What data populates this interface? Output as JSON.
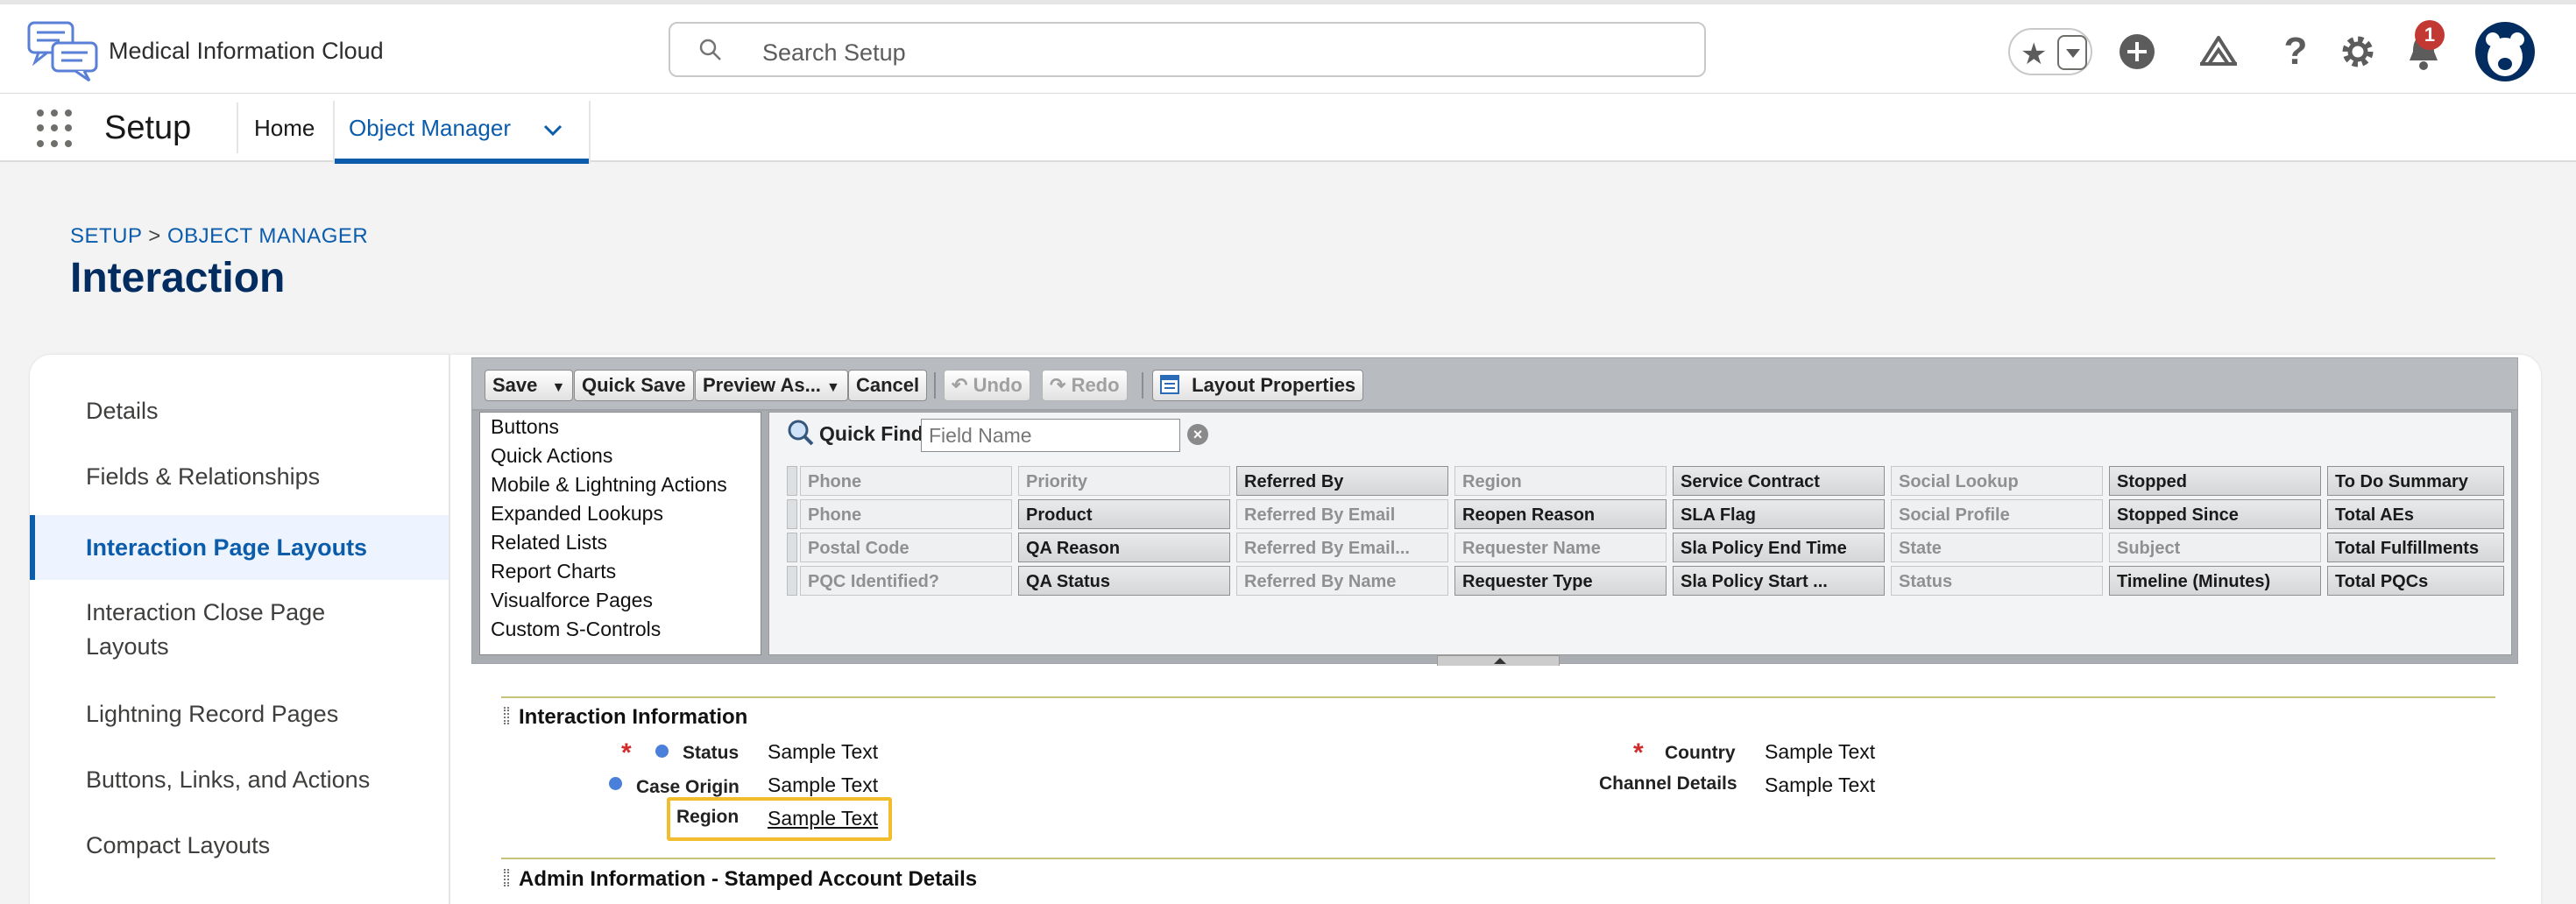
{
  "header": {
    "app_name": "Medical Information Cloud",
    "search_placeholder": "Search Setup",
    "notification_count": "1",
    "icons": [
      "favorites-star-icon",
      "favorites-dropdown-icon",
      "add-icon",
      "trailhead-icon",
      "help-icon",
      "gear-icon",
      "bell-icon",
      "avatar"
    ]
  },
  "context_bar": {
    "title": "Setup",
    "tabs": [
      {
        "label": "Home"
      },
      {
        "label": "Object Manager",
        "active": true
      }
    ]
  },
  "breadcrumb": {
    "setup": "SETUP",
    "separator": ">",
    "object_manager": "OBJECT MANAGER"
  },
  "page_title": "Interaction",
  "sidebar": {
    "items": [
      {
        "label": "Details"
      },
      {
        "label": "Fields & Relationships"
      },
      {
        "label": "Interaction Page Layouts",
        "active": true
      },
      {
        "label_line1": "Interaction Close Page",
        "label_line2": "Layouts"
      },
      {
        "label": "Lightning Record Pages"
      },
      {
        "label": "Buttons, Links, and Actions"
      },
      {
        "label": "Compact Layouts"
      }
    ]
  },
  "toolbar": {
    "save": "Save",
    "quick_save": "Quick Save",
    "preview_as": "Preview As...",
    "cancel": "Cancel",
    "undo": "Undo",
    "redo": "Redo",
    "layout_properties": "Layout Properties"
  },
  "palette": {
    "categories": [
      "Buttons",
      "Quick Actions",
      "Mobile & Lightning Actions",
      "Expanded Lookups",
      "Related Lists",
      "Report Charts",
      "Visualforce Pages",
      "Custom S-Controls"
    ],
    "quick_find_label": "Quick Find",
    "quick_find_placeholder": "Field Name",
    "columns": [
      [
        "Phone",
        "Phone",
        "Postal Code",
        "PQC Identified?"
      ],
      [
        "Priority",
        "Product",
        "QA Reason",
        "QA Status"
      ],
      [
        "Referred By",
        "Referred By Email",
        "Referred By Email...",
        "Referred By Name"
      ],
      [
        "Region",
        "Reopen Reason",
        "Requester Name",
        "Requester Type"
      ],
      [
        "Service Contract",
        "SLA Flag",
        "Sla Policy End Time",
        "Sla Policy Start ..."
      ],
      [
        "Social Lookup",
        "Social Profile",
        "State",
        "Status"
      ],
      [
        "Stopped",
        "Stopped Since",
        "Subject",
        "Timeline (Minutes)"
      ],
      [
        "To Do Summary",
        "Total AEs",
        "Total Fulfillments",
        "Total PQCs"
      ]
    ]
  },
  "layout": {
    "section1_title": "Interaction Information",
    "section2_title": "Admin Information - Stamped Account Details",
    "fields": {
      "status_label": "Status",
      "status_value": "Sample Text",
      "case_origin_label": "Case Origin",
      "case_origin_value": "Sample Text",
      "region_label": "Region",
      "region_value": "Sample Text",
      "country_label": "Country",
      "country_value": "Sample Text",
      "channel_label": "Channel Details",
      "channel_value": "Sample Text"
    }
  },
  "colors": {
    "brand_blue": "#0b5cab",
    "title_navy": "#032d60",
    "highlight": "#f2bd2c",
    "required_red": "#d12b2b"
  }
}
